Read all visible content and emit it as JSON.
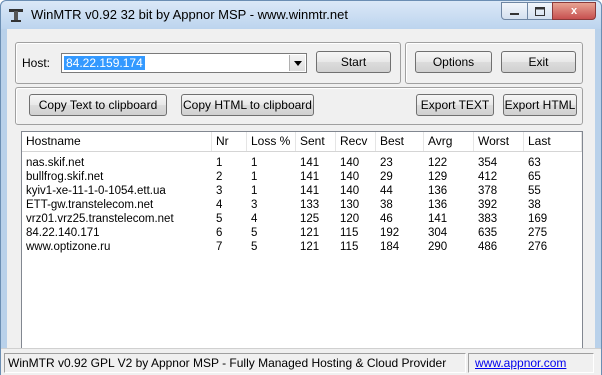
{
  "window": {
    "title": "WinMTR v0.92 32 bit by Appnor MSP - www.winmtr.net",
    "close_glyph": "x",
    "icon": "winmtr-app-icon"
  },
  "host": {
    "label": "Host:",
    "value": "84.22.159.174"
  },
  "buttons": {
    "start": "Start",
    "options": "Options",
    "exit": "Exit",
    "copy_text": "Copy Text to clipboard",
    "copy_html": "Copy HTML to clipboard",
    "export_text": "Export TEXT",
    "export_html": "Export HTML"
  },
  "table": {
    "columns": [
      "Hostname",
      "Nr",
      "Loss %",
      "Sent",
      "Recv",
      "Best",
      "Avrg",
      "Worst",
      "Last"
    ],
    "rows": [
      [
        "nas.skif.net",
        "1",
        "1",
        "141",
        "140",
        "23",
        "122",
        "354",
        "63"
      ],
      [
        "bullfrog.skif.net",
        "2",
        "1",
        "141",
        "140",
        "29",
        "129",
        "412",
        "65"
      ],
      [
        "kyiv1-xe-11-1-0-1054.ett.ua",
        "3",
        "1",
        "141",
        "140",
        "44",
        "136",
        "378",
        "55"
      ],
      [
        "ETT-gw.transtelecom.net",
        "4",
        "3",
        "133",
        "130",
        "38",
        "136",
        "392",
        "38"
      ],
      [
        "vrz01.vrz25.transtelecom.net",
        "5",
        "4",
        "125",
        "120",
        "46",
        "141",
        "383",
        "169"
      ],
      [
        "84.22.140.171",
        "6",
        "5",
        "121",
        "115",
        "192",
        "304",
        "635",
        "275"
      ],
      [
        "www.optizone.ru",
        "7",
        "5",
        "121",
        "115",
        "184",
        "290",
        "486",
        "276"
      ]
    ]
  },
  "status": {
    "text": "WinMTR v0.92 GPL V2 by Appnor MSP - Fully Managed Hosting & Cloud Provider",
    "link": "www.appnor.com"
  },
  "colors": {
    "selection": "#3399ff",
    "link": "#0000ee",
    "close_button": "#c75050"
  }
}
